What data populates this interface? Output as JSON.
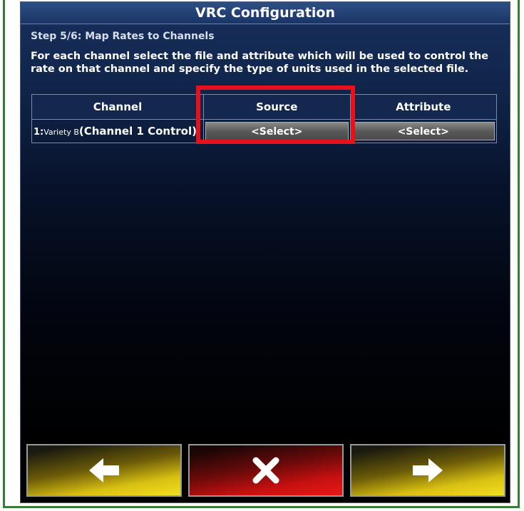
{
  "window": {
    "title": "VRC Configuration"
  },
  "step": {
    "title": "Step 5/6: Map Rates to Channels"
  },
  "instructions": "For each channel select the file and attribute which will be used to control the rate on that channel and specify the type of units used in the selected file.",
  "table": {
    "headers": {
      "channel": "Channel",
      "source": "Source",
      "attribute": "Attribute"
    },
    "rows": [
      {
        "num": "1:",
        "variety": "Variety B",
        "channel_label": "(Channel 1 Control)",
        "source": "<Select>",
        "attribute": "<Select>"
      }
    ]
  },
  "nav": {
    "back_icon": "arrow-left-icon",
    "cancel_icon": "close-icon",
    "next_icon": "arrow-right-icon"
  },
  "colors": {
    "highlight": "#e8111b",
    "back": "#f2e020",
    "cancel": "#e81818",
    "next": "#f2e020"
  }
}
